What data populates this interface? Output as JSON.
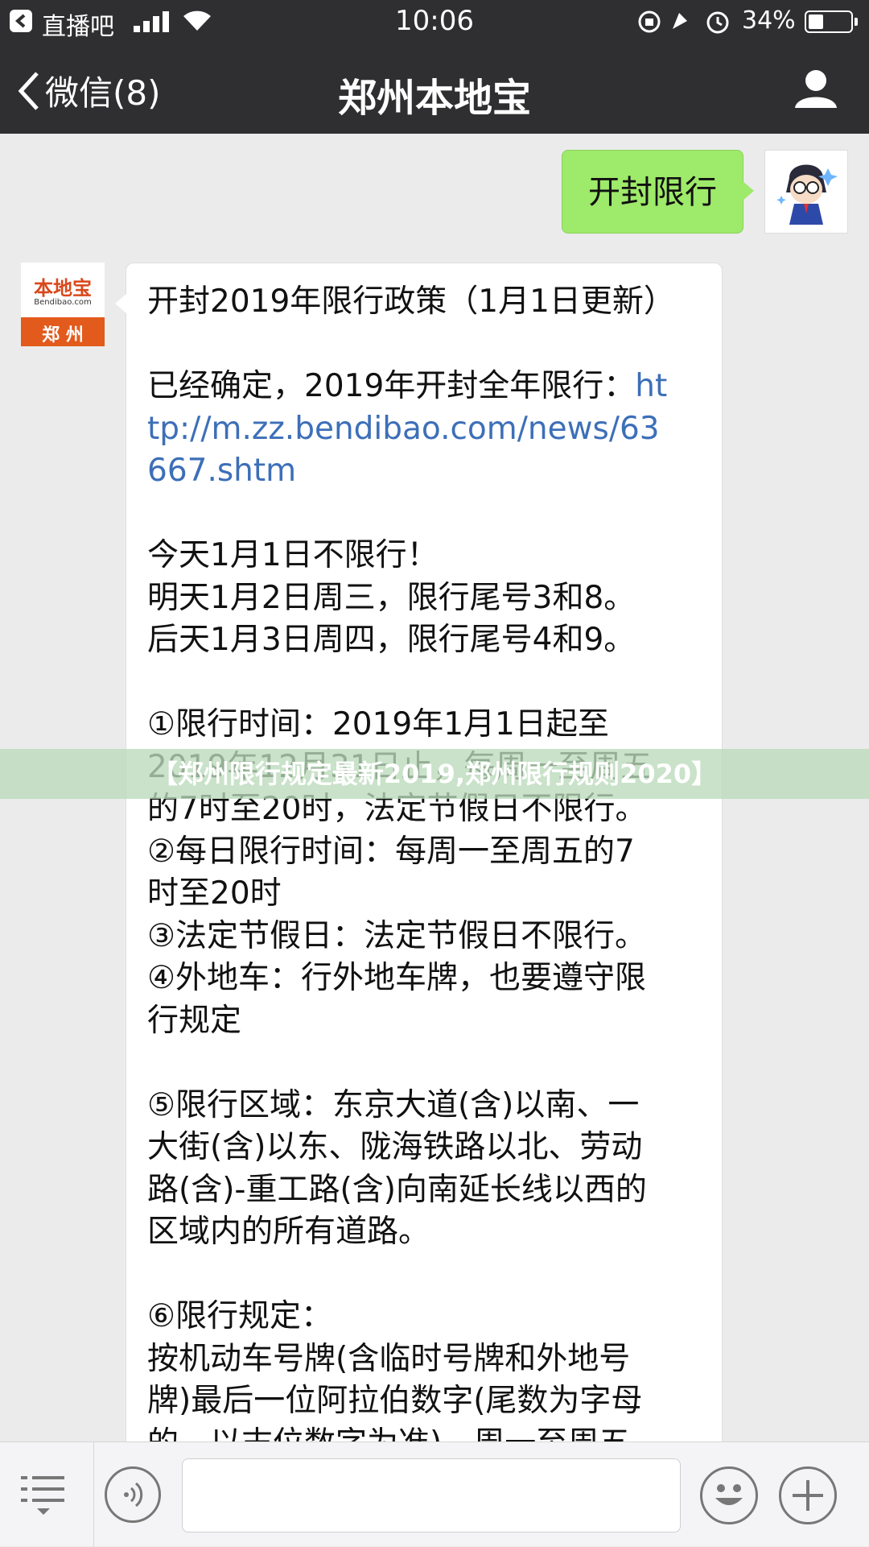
{
  "status_bar": {
    "back_app": "直播吧",
    "time": "10:06",
    "battery": "34%"
  },
  "nav": {
    "back_label": "微信(8)",
    "title": "郑州本地宝",
    "back_icon": "chevron-left-icon",
    "profile_icon": "person-icon"
  },
  "chat": {
    "user_message": "开封限行",
    "bot_avatar": {
      "brand": "本地宝",
      "sub": "Bendibao.com",
      "city": "郑 州"
    },
    "bot_message_lines": [
      {
        "text": "开封2019年限行政策（1月1日更新）"
      },
      {
        "text": ""
      },
      {
        "text": "已经确定，2019年开封全年限行：",
        "link": "ht"
      },
      {
        "text": "",
        "link": "tp://m.zz.bendibao.com/news/63"
      },
      {
        "text": "",
        "link": "667.shtm"
      },
      {
        "text": ""
      },
      {
        "text": "今天1月1日不限行！"
      },
      {
        "text": "明天1月2日周三，限行尾号3和8。"
      },
      {
        "text": "后天1月3日周四，限行尾号4和9。"
      },
      {
        "text": ""
      },
      {
        "text": "①限行时间：2019年1月1日起至"
      },
      {
        "text": "2019年12月31日止，每周一至周五"
      },
      {
        "text": "的7时至20时，法定节假日不限行。"
      },
      {
        "text": "②每日限行时间：每周一至周五的7"
      },
      {
        "text": "时至20时"
      },
      {
        "text": "③法定节假日：法定节假日不限行。"
      },
      {
        "text": "④外地车：行外地车牌，也要遵守限"
      },
      {
        "text": "行规定"
      },
      {
        "text": ""
      },
      {
        "text": "⑤限行区域：东京大道(含)以南、一"
      },
      {
        "text": "大街(含)以东、陇海铁路以北、劳动"
      },
      {
        "text": "路(含)-重工路(含)向南延长线以西的"
      },
      {
        "text": "区域内的所有道路。"
      },
      {
        "text": ""
      },
      {
        "text": "⑥限行规定："
      },
      {
        "text": "按机动车号牌(含临时号牌和外地号"
      },
      {
        "text": "牌)最后一位阿拉伯数字(尾数为字母"
      },
      {
        "text": "的，以末位数字为准)，周一至周五"
      }
    ]
  },
  "watermark": "【郑州限行规定最新2019,郑州限行规则2020】",
  "bottom_bar": {
    "menu_icon": "menu-icon",
    "voice_icon": "voice-icon",
    "emoji_icon": "emoji-icon",
    "plus_icon": "plus-icon"
  }
}
